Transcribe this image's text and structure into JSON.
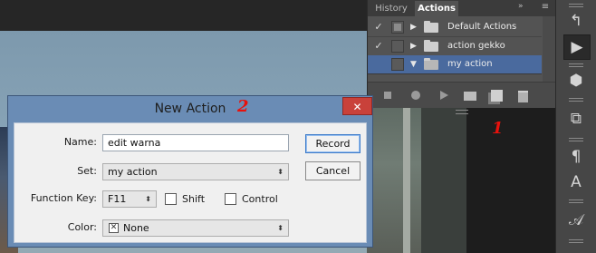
{
  "panel": {
    "tabs": [
      "History",
      "Actions"
    ],
    "collapse_glyph": "»",
    "menu_glyph": "≡",
    "rows": [
      {
        "label": "Default Actions",
        "checked": true,
        "dialog_on": true,
        "expanded": false
      },
      {
        "label": "action gekko",
        "checked": true,
        "dialog_on": false,
        "expanded": false
      },
      {
        "label": "my action",
        "checked": false,
        "dialog_on": false,
        "expanded": true
      }
    ],
    "checkmark": "✓",
    "collapsed_arrow": "▶",
    "expanded_arrow": "▼",
    "footer_icons": [
      "stop-icon",
      "record-icon",
      "play-icon",
      "new-set-folder-icon",
      "new-action-icon",
      "trash-icon"
    ]
  },
  "toolstrip": {
    "tools": [
      "history-brush-icon",
      "play-actions-icon",
      "3d-cube-icon",
      "paths-icon",
      "character-icon",
      "paragraph-icon",
      "glyphs-icon"
    ],
    "glyphs": [
      "↰",
      "▶",
      "⬢",
      "⧉",
      "¶",
      "A",
      "𝒜"
    ]
  },
  "dialog": {
    "title": "New Action",
    "close": "✕",
    "name_label": "Name:",
    "name_value": "edit warna",
    "set_label": "Set:",
    "set_value": "my action",
    "fkey_label": "Function Key:",
    "fkey_value": "F11",
    "shift_label": "Shift",
    "control_label": "Control",
    "color_label": "Color:",
    "color_value": "None",
    "color_swatch": "✕",
    "record_button": "Record",
    "cancel_button": "Cancel",
    "select_arrows": "⬍"
  },
  "annotations": {
    "one": "1",
    "two": "2"
  },
  "colors": {
    "accent_selection": "#4a6a9e",
    "annotation_red": "#e8110c",
    "dialog_frame": "#6a8cb5",
    "close_red": "#c9413a"
  }
}
